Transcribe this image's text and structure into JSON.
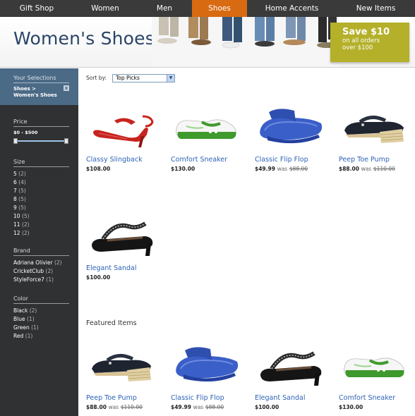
{
  "nav": {
    "items": [
      {
        "label": "Gift Shop"
      },
      {
        "label": "Women"
      },
      {
        "label": "Men"
      },
      {
        "label": "Shoes",
        "active": true
      },
      {
        "label": "Home Accents"
      },
      {
        "label": "New Items"
      }
    ]
  },
  "header": {
    "title": "Women's Shoes",
    "promo": {
      "headline": "Save $10",
      "line1": "on all orders",
      "line2": "over $100"
    }
  },
  "sidebar": {
    "selections": {
      "heading": "Your Selections",
      "value": "Shoes > Women's Shoes",
      "remove": "x"
    },
    "price": {
      "heading": "Price",
      "range": "$0 - $500",
      "min_fraction": 0,
      "max_fraction": 1
    },
    "size": {
      "heading": "Size",
      "items": [
        {
          "label": "5",
          "count": "(2)"
        },
        {
          "label": "6",
          "count": "(4)"
        },
        {
          "label": "7",
          "count": "(5)"
        },
        {
          "label": "8",
          "count": "(5)"
        },
        {
          "label": "9",
          "count": "(5)"
        },
        {
          "label": "10",
          "count": "(5)"
        },
        {
          "label": "11",
          "count": "(2)"
        },
        {
          "label": "12",
          "count": "(2)"
        }
      ]
    },
    "brand": {
      "heading": "Brand",
      "items": [
        {
          "label": "Adriana Olivier",
          "count": "(2)"
        },
        {
          "label": "CricketClub",
          "count": "(2)"
        },
        {
          "label": "StyleForce7",
          "count": "(1)"
        }
      ]
    },
    "color": {
      "heading": "Color",
      "items": [
        {
          "label": "Black",
          "count": "(2)"
        },
        {
          "label": "Blue",
          "count": "(1)"
        },
        {
          "label": "Green",
          "count": "(1)"
        },
        {
          "label": "Red",
          "count": "(1)"
        }
      ]
    }
  },
  "sort": {
    "label": "Sort by:",
    "selected": "Top Picks"
  },
  "products": [
    {
      "name": "Classy Slingback",
      "price": "$108.00",
      "was_label": "",
      "old_price": "",
      "icon": "red-slingback-icon"
    },
    {
      "name": "Comfort Sneaker",
      "price": "$130.00",
      "was_label": "",
      "old_price": "",
      "icon": "green-sneaker-icon"
    },
    {
      "name": "Classic Flip Flop",
      "price": "$49.99",
      "was_label": "was",
      "old_price": "$88.00",
      "icon": "blue-flipflop-icon"
    },
    {
      "name": "Peep Toe Pump",
      "price": "$88.00",
      "was_label": "was",
      "old_price": "$110.00",
      "icon": "black-wedge-icon"
    },
    {
      "name": "Elegant Sandal",
      "price": "$100.00",
      "was_label": "",
      "old_price": "",
      "icon": "black-sandal-icon"
    }
  ],
  "featured": {
    "title": "Featured Items",
    "items": [
      {
        "name": "Peep Toe Pump",
        "price": "$88.00",
        "was_label": "was",
        "old_price": "$110.00",
        "icon": "black-wedge-icon"
      },
      {
        "name": "Classic Flip Flop",
        "price": "$49.99",
        "was_label": "was",
        "old_price": "$88.00",
        "icon": "blue-flipflop-icon"
      },
      {
        "name": "Elegant Sandal",
        "price": "$100.00",
        "was_label": "",
        "old_price": "",
        "icon": "black-sandal-icon"
      },
      {
        "name": "Comfort Sneaker",
        "price": "$130.00",
        "was_label": "",
        "old_price": "",
        "icon": "green-sneaker-icon"
      }
    ]
  },
  "colors": {
    "nav_bg": "#3a3a3a",
    "nav_active": "#d86a12",
    "sidebar_bg": "#2f3133",
    "selection_bg": "#4b6a86",
    "link": "#2d63b6",
    "promo": "#b4b02a"
  }
}
